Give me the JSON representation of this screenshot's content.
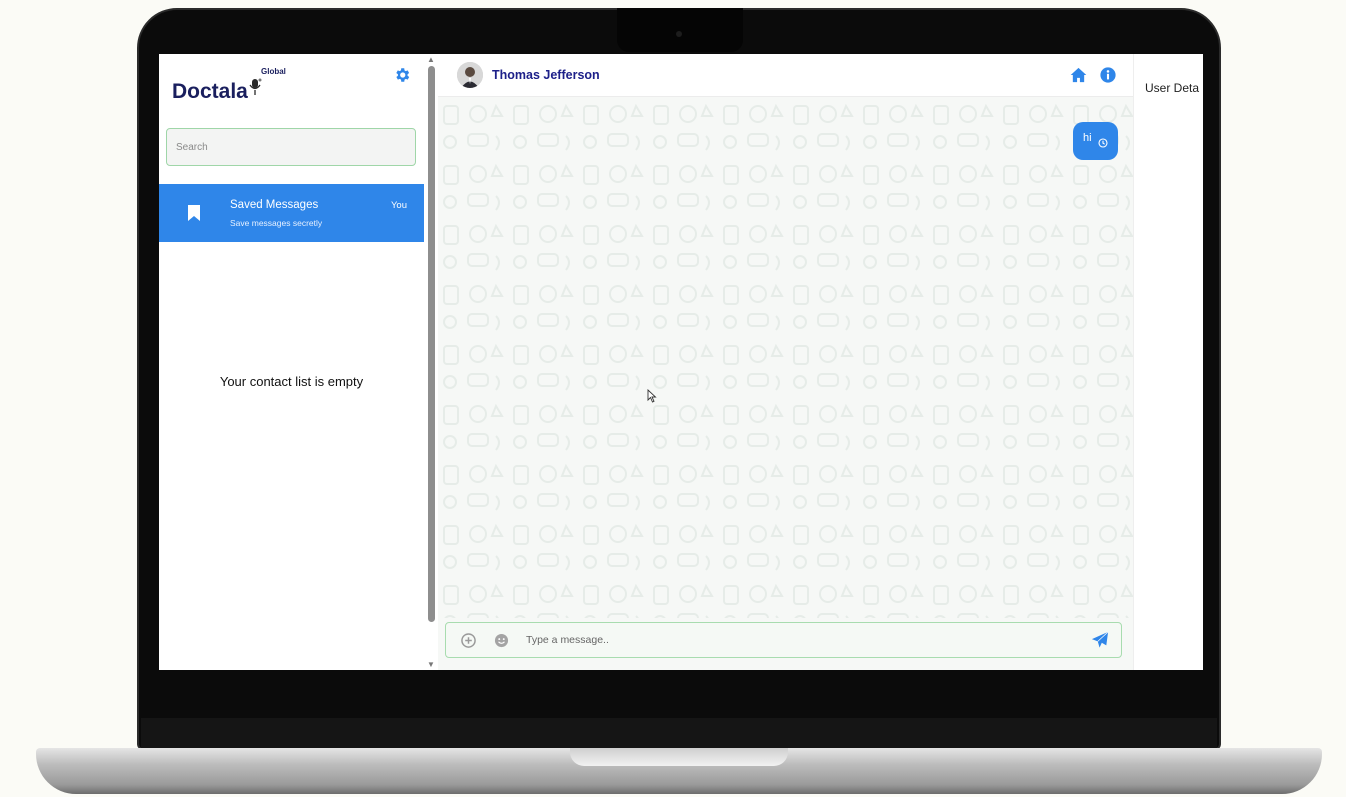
{
  "sidebar": {
    "logo_text": "Doctala",
    "logo_badge": "Global",
    "settings_icon": "gear-icon",
    "search_placeholder": "Search",
    "saved_item": {
      "icon": "bookmark-icon",
      "title": "Saved Messages",
      "subtitle": "Save messages secretly",
      "tag": "You"
    },
    "empty_message": "Your contact list is empty"
  },
  "chat": {
    "contact_name": "Thomas Jefferson",
    "header_icons": [
      "home-icon",
      "info-icon"
    ],
    "messages": [
      {
        "text": "hi",
        "direction": "outgoing",
        "status_icon": "clock-icon"
      }
    ],
    "composer": {
      "placeholder": "Type a message..",
      "left_icons": [
        "add-icon",
        "emoji-icon"
      ],
      "send_icon": "send-icon"
    }
  },
  "details_panel": {
    "title": "User Deta"
  },
  "colors": {
    "accent": "#2f86e9",
    "brand_text": "#1a1f5e",
    "contact_name": "#1d2089",
    "input_border": "#a8dcaf"
  }
}
